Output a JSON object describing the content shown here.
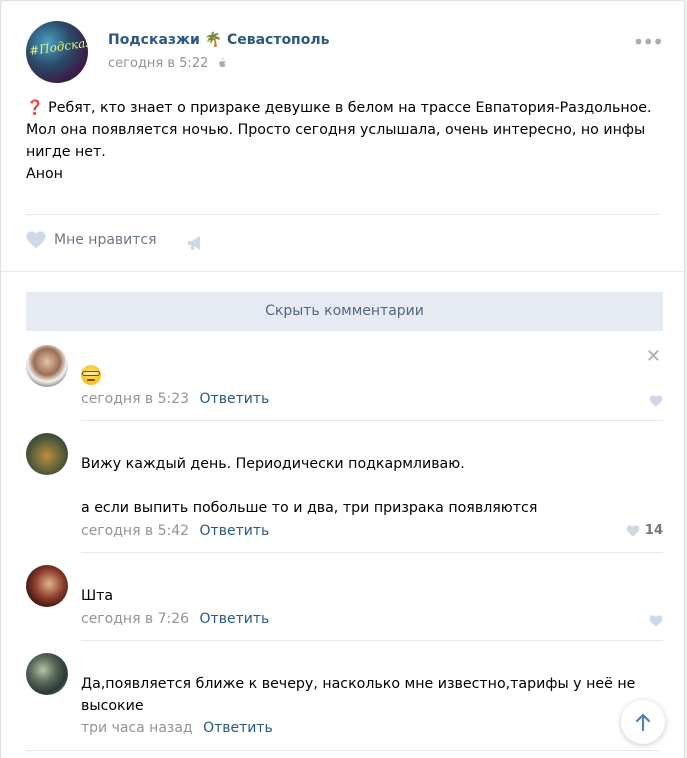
{
  "post": {
    "group_name": "Подсказжи",
    "group_name_city": "Севастополь",
    "palm_emoji": "🌴",
    "avatar_text": "#Подсказжи",
    "date": "сегодня в 5:22",
    "text_lines": [
      "❓ Ребят, кто знает о призраке девушке в белом на трассе Евпатория-Раздольное.",
      "Мол она появляется ночью. Просто сегодня услышала, очень интересно, но инфы",
      "нигде нет.",
      "Анон"
    ],
    "like_label": "Мне нравится"
  },
  "comments_toggle": "Скрыть комментарии",
  "comments": [
    {
      "time": "сегодня в 5:23",
      "reply": "Ответить",
      "likes": ""
    },
    {
      "text_lines": [
        "Вижу каждый день. Периодически подкармливаю.",
        "",
        "а если выпить побольше то и два, три призрака появляются"
      ],
      "time": "сегодня в 5:42",
      "reply": "Ответить",
      "likes": "14"
    },
    {
      "text_lines": [
        "Шта"
      ],
      "time": "сегодня в 7:26",
      "reply": "Ответить",
      "likes": ""
    },
    {
      "text_lines": [
        "Да,появляется ближе к вечеру, насколько мне известно,тарифы у неё не",
        "высокие"
      ],
      "time": "три часа назад",
      "reply": "Ответить",
      "likes": ""
    }
  ],
  "colors": {
    "link": "#2a5885",
    "meta": "#939393",
    "button_bg": "#e5ebf1"
  }
}
